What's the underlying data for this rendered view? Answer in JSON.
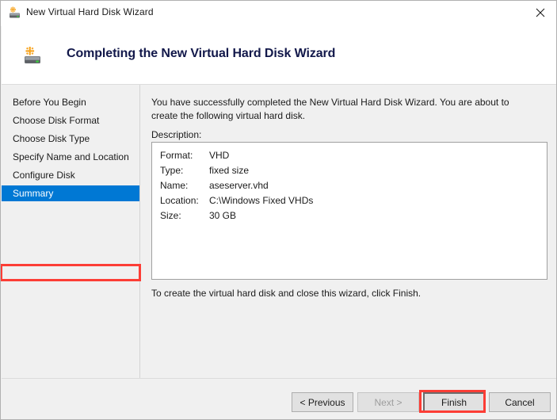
{
  "titlebar": {
    "title": "New Virtual Hard Disk Wizard",
    "icon": "vhd-disk-icon",
    "close_label": "✕"
  },
  "header": {
    "title": "Completing the New Virtual Hard Disk Wizard",
    "icon": "vhd-disk-icon"
  },
  "sidebar": {
    "items": [
      {
        "label": "Before You Begin",
        "selected": false
      },
      {
        "label": "Choose Disk Format",
        "selected": false
      },
      {
        "label": "Choose Disk Type",
        "selected": false
      },
      {
        "label": "Specify Name and Location",
        "selected": false
      },
      {
        "label": "Configure Disk",
        "selected": false
      },
      {
        "label": "Summary",
        "selected": true
      }
    ]
  },
  "main": {
    "intro": "You have successfully completed the New Virtual Hard Disk Wizard. You are about to create the following virtual hard disk.",
    "description_label": "Description:",
    "description_rows": [
      {
        "key": "Format:",
        "value": "VHD"
      },
      {
        "key": "Type:",
        "value": "fixed size"
      },
      {
        "key": "Name:",
        "value": "aseserver.vhd"
      },
      {
        "key": "Location:",
        "value": "C:\\Windows Fixed VHDs"
      },
      {
        "key": "Size:",
        "value": "30 GB"
      }
    ],
    "footer_note": "To create the virtual hard disk and close this wizard, click Finish."
  },
  "buttons": {
    "previous": "< Previous",
    "next": "Next >",
    "finish": "Finish",
    "cancel": "Cancel"
  },
  "colors": {
    "selection_blue": "#0078d4",
    "annotation_red": "#fc3d35",
    "header_title": "#12184a",
    "window_bg": "#f0f0f0"
  }
}
